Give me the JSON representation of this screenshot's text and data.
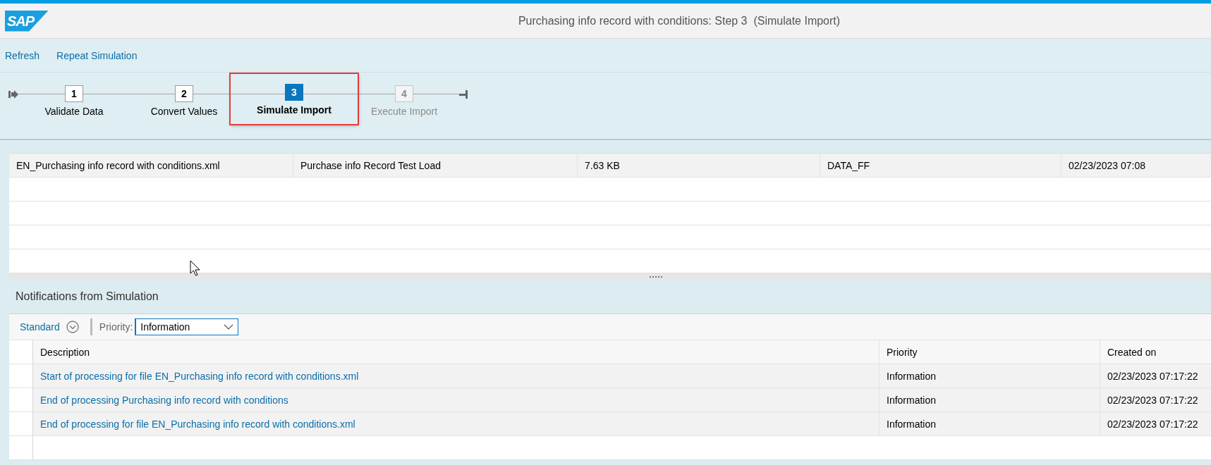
{
  "header": {
    "logo": "SAP",
    "title": "Purchasing info record with conditions: Step 3  (Simulate Import)"
  },
  "actions": [
    "Refresh",
    "Repeat Simulation"
  ],
  "steps": [
    {
      "number": "1",
      "label": "Validate Data",
      "selected": false,
      "disabled": false,
      "highlighted": false
    },
    {
      "number": "2",
      "label": "Convert Values",
      "selected": false,
      "disabled": false,
      "highlighted": false
    },
    {
      "number": "3",
      "label": "Simulate Import",
      "selected": true,
      "disabled": false,
      "highlighted": true
    },
    {
      "number": "4",
      "label": "Execute Import",
      "selected": false,
      "disabled": true,
      "highlighted": false
    }
  ],
  "files_table": {
    "rows": [
      {
        "column_1": "EN_Purchasing info record with conditions.xml",
        "column_2": "Purchase info Record Test Load",
        "column_3": "7.63 KB",
        "column_4": "DATA_FF",
        "column_5": "02/23/2023 07:08"
      }
    ]
  },
  "notifications": {
    "title": "Notifications from Simulation",
    "variant": "Standard",
    "filter": {
      "label": "Priority:",
      "value": "Information"
    },
    "columns": [
      "Description",
      "Priority",
      "Created on"
    ],
    "rows": [
      {
        "description": "Start of processing for file EN_Purchasing info record with conditions.xml",
        "priority": "Information",
        "created_on": "02/23/2023 07:17:22"
      },
      {
        "description": "End of processing Purchasing info record with conditions",
        "priority": "Information",
        "created_on": "02/23/2023 07:17:22"
      },
      {
        "description": "End of processing for file EN_Purchasing info record with conditions.xml",
        "priority": "Information",
        "created_on": "02/23/2023 07:17:22"
      }
    ]
  }
}
